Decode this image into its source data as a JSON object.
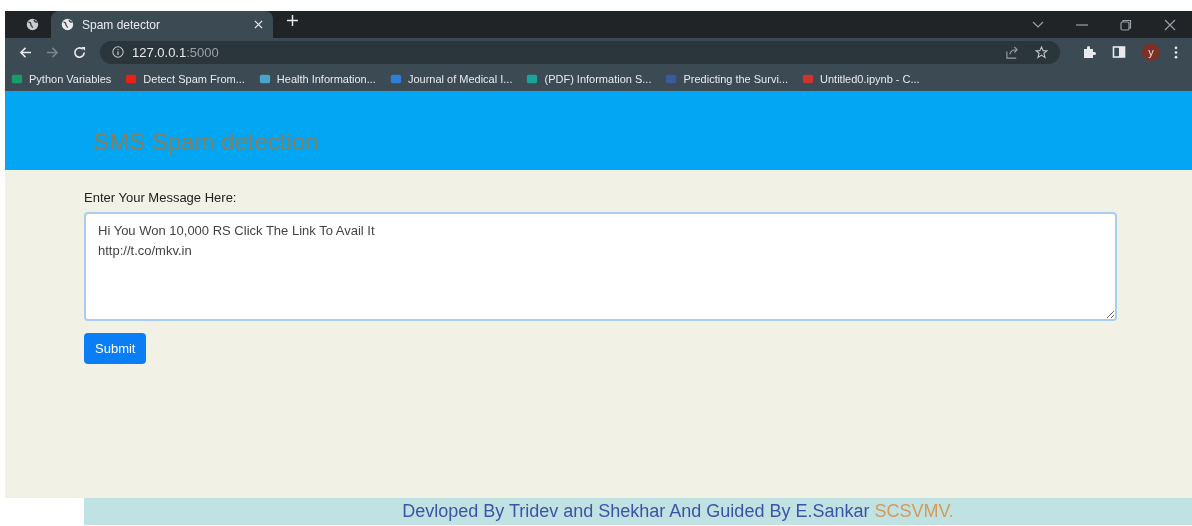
{
  "browser": {
    "tabs": [
      {
        "kind": "pinned",
        "selected": false
      },
      {
        "kind": "page",
        "label": "Spam detector",
        "selected": true
      }
    ],
    "address": {
      "host": "127.0.0.1",
      "port": ":5000"
    },
    "profile_initial": "y",
    "bookmarks": [
      {
        "label": "Python Variables",
        "color": "#1a9c6a"
      },
      {
        "label": "Detect Spam From...",
        "color": "#e62117"
      },
      {
        "label": "Health Information...",
        "color": "#4aa3c8"
      },
      {
        "label": "Journal of Medical I...",
        "color": "#2f7fd6"
      },
      {
        "label": "(PDF) Information S...",
        "color": "#1aa39a"
      },
      {
        "label": "Predicting the Survi...",
        "color": "#3a5a9c"
      },
      {
        "label": "Untitled0.ipynb - C...",
        "color": "#d0332e"
      }
    ]
  },
  "header": {
    "title": "SMS Spam detection"
  },
  "form": {
    "label": "Enter Your Message Here:",
    "message": "Hi You Won 10,000 RS Click The Link To Avail It\nhttp://t.co/mkv.in",
    "submit": "Submit"
  },
  "footer": {
    "text": "Devloped By Tridev and Shekhar And Guided By E.Sankar",
    "highlight": "SCSVMV."
  }
}
